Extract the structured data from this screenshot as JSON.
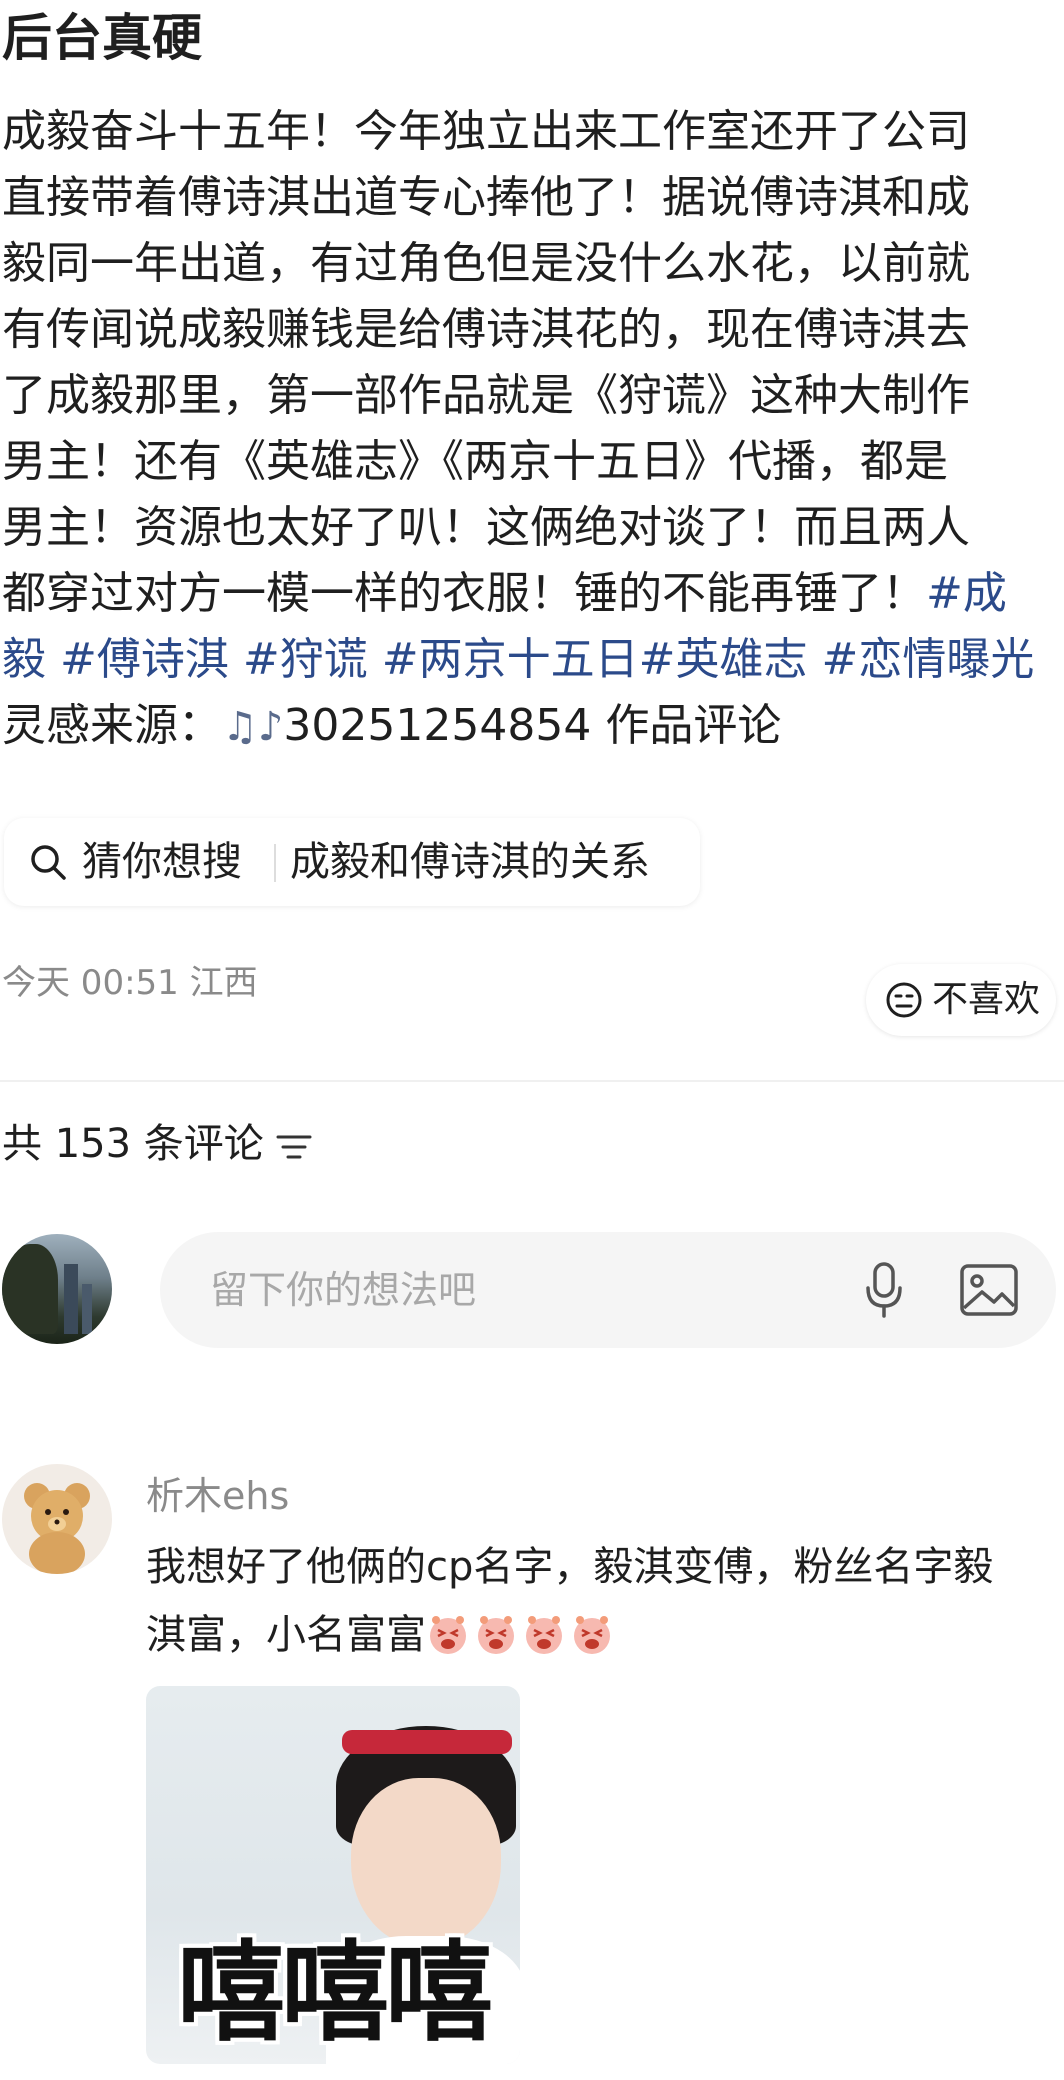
{
  "post": {
    "title": "后台真硬",
    "body_lines": [
      "成毅奋斗十五年！今年独立出来工作室还开了公司",
      "直接带着傅诗淇出道专心捧他了！据说傅诗淇和成",
      "毅同一年出道，有过角色但是没什么水花，以前就",
      "有传闻说成毅赚钱是给傅诗淇花的，现在傅诗淇去",
      "了成毅那里，第一部作品就是《狩谎》这种大制作",
      "男主！还有《英雄志》《两京十五日》代播，都是",
      "男主！资源也太好了叭！这俩绝对谈了！而且两人"
    ],
    "line8_text": "都穿过对方一模一样的衣服！锤的不能再锤了！",
    "line8_tag": "#成",
    "line9_tags": [
      "毅",
      "#傅诗淇",
      "#狩谎",
      "#两京十五日#英雄志",
      "#恋情曝光"
    ],
    "source_label": "灵感来源：",
    "source_icon": "music-notes-icon",
    "source_id": "30251254854",
    "source_suffix": "作品评论",
    "search_chip": {
      "label": "猜你想搜",
      "query": "成毅和傅诗淇的关系"
    },
    "meta": "今天 00:51 江西",
    "dislike_label": "不喜欢"
  },
  "comments_section": {
    "header": "共 153 条评论",
    "input_placeholder": "留下你的想法吧"
  },
  "comment": {
    "username": "析木ehs",
    "line1": "我想好了他俩的cp名字，毅淇变傅，粉丝名字毅",
    "line2": "淇富，小名富富",
    "emoji_count": 4,
    "sticker_caption": "嘻嘻嘻"
  },
  "colors": {
    "tag": "#2b4a8a",
    "meta": "#8a8a8a",
    "placeholder": "#a8a8a8"
  }
}
